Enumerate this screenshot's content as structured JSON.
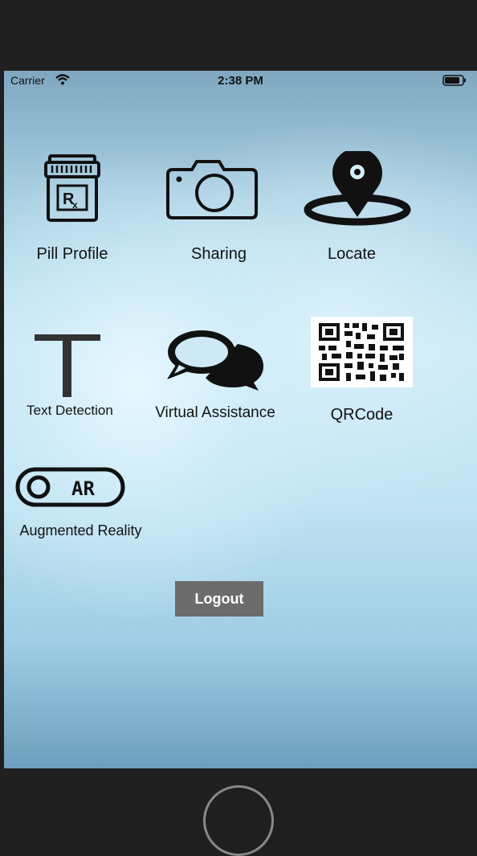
{
  "status_bar": {
    "carrier": "Carrier",
    "time": "2:38 PM"
  },
  "menu": [
    {
      "label": "Pill Profile",
      "icon": "pill-bottle-icon"
    },
    {
      "label": "Sharing",
      "icon": "camera-icon"
    },
    {
      "label": "Locate",
      "icon": "location-pin-icon"
    },
    {
      "label": "Text Detection",
      "icon": "letter-t-icon"
    },
    {
      "label": "Virtual Assistance",
      "icon": "chat-bubbles-icon"
    },
    {
      "label": "QRCode",
      "icon": "qr-code-icon"
    },
    {
      "label": "Augmented Reality",
      "icon": "ar-toggle-icon",
      "icon_text": "AR"
    }
  ],
  "logout_label": "Logout",
  "colors": {
    "button_bg": "#6c6c6c",
    "frame": "#1f1f1f"
  }
}
